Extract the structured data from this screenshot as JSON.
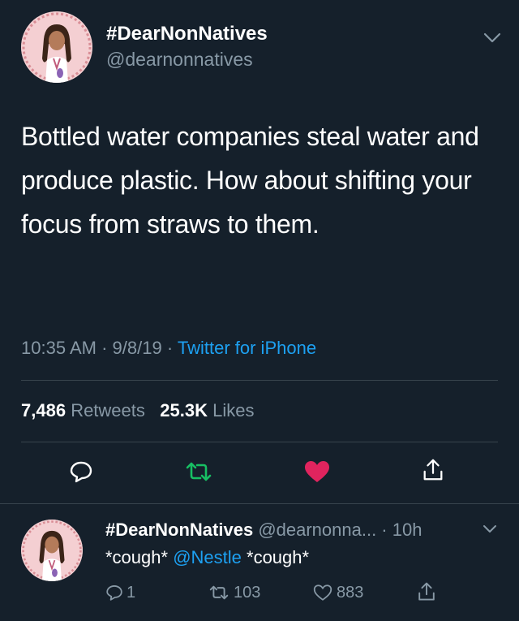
{
  "tweet": {
    "display_name": "#DearNonNatives",
    "handle": "@dearnonnatives",
    "text": "Bottled water companies steal water and produce plastic. How about shifting your focus from straws to them.",
    "time": "10:35 AM",
    "date": "9/8/19",
    "source": "Twitter for iPhone",
    "retweets_count": "7,486",
    "retweets_label": "Retweets",
    "likes_count": "25.3K",
    "likes_label": "Likes"
  },
  "reply": {
    "display_name": "#DearNonNatives",
    "handle_time": "@dearnonna... · 10h",
    "text_before": "*cough* ",
    "mention": "@Nestle",
    "text_after": " *cough*",
    "replies_count": "1",
    "retweets_count": "103",
    "likes_count": "883"
  },
  "icons": {
    "reply": "comment-icon",
    "retweet": "retweet-icon",
    "like": "heart-icon",
    "share": "share-icon",
    "more": "chevron-down-icon"
  },
  "colors": {
    "background": "#15202b",
    "link": "#1da1f2",
    "retweet_green": "#17bf63",
    "like_red": "#e0245e",
    "secondary_text": "#8899a6"
  }
}
